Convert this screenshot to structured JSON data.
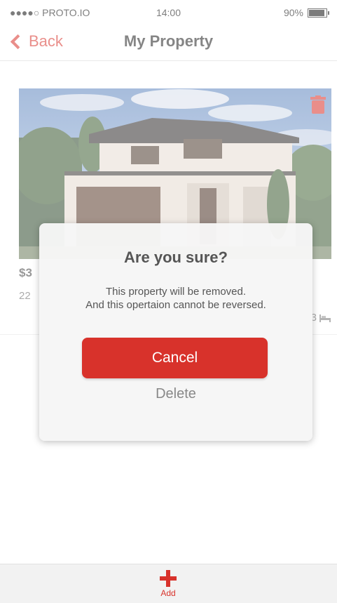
{
  "status_bar": {
    "carrier": "●●●●○ PROTO.IO",
    "time": "14:00",
    "battery": "90%"
  },
  "nav": {
    "back_label": "Back",
    "title": "My Property"
  },
  "property": {
    "price": "$3",
    "address": "22",
    "beds": "3"
  },
  "dialog": {
    "title": "Are you sure?",
    "message_line1": "This property will be removed.",
    "message_line2": "And this opertaion cannot be reversed.",
    "cancel_label": "Cancel",
    "delete_label": "Delete"
  },
  "tab_bar": {
    "add_label": "Add"
  },
  "colors": {
    "accent": "#d8322b",
    "sky": "#7fa3cf"
  },
  "icons": [
    "chevron-left-icon",
    "trash-icon",
    "bed-icon",
    "plus-icon",
    "battery-icon"
  ]
}
